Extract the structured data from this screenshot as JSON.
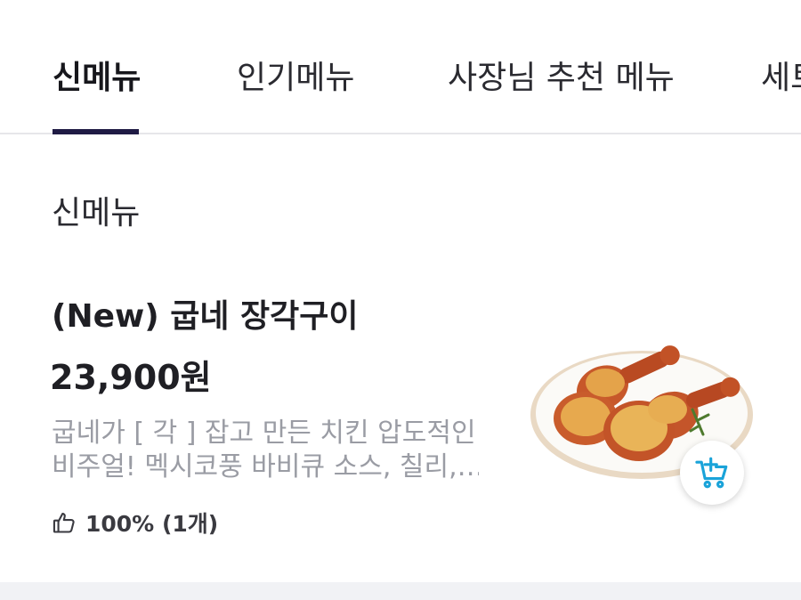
{
  "tabs": [
    {
      "label": "신메뉴",
      "active": true
    },
    {
      "label": "인기메뉴",
      "active": false
    },
    {
      "label": "사장님 추천 메뉴",
      "active": false
    },
    {
      "label": "세트",
      "active": false
    }
  ],
  "section": {
    "title": "신메뉴"
  },
  "item": {
    "name": "(New) 굽네 장각구이",
    "price": "23,900원",
    "description_lines": [
      "굽네가 [ 각 ] 잡고 만든 치킨 압도적인",
      "비주얼! 멕시코풍 바비큐 소스, 칠리,…"
    ],
    "rating": "100% (1개)",
    "rating_icon": "thumbs-up-icon",
    "cart_icon": "cart-plus-icon"
  },
  "colors": {
    "tab_underline": "#1f1b44",
    "cart_accent": "#1aa3d9",
    "description": "#9a9ca4"
  }
}
